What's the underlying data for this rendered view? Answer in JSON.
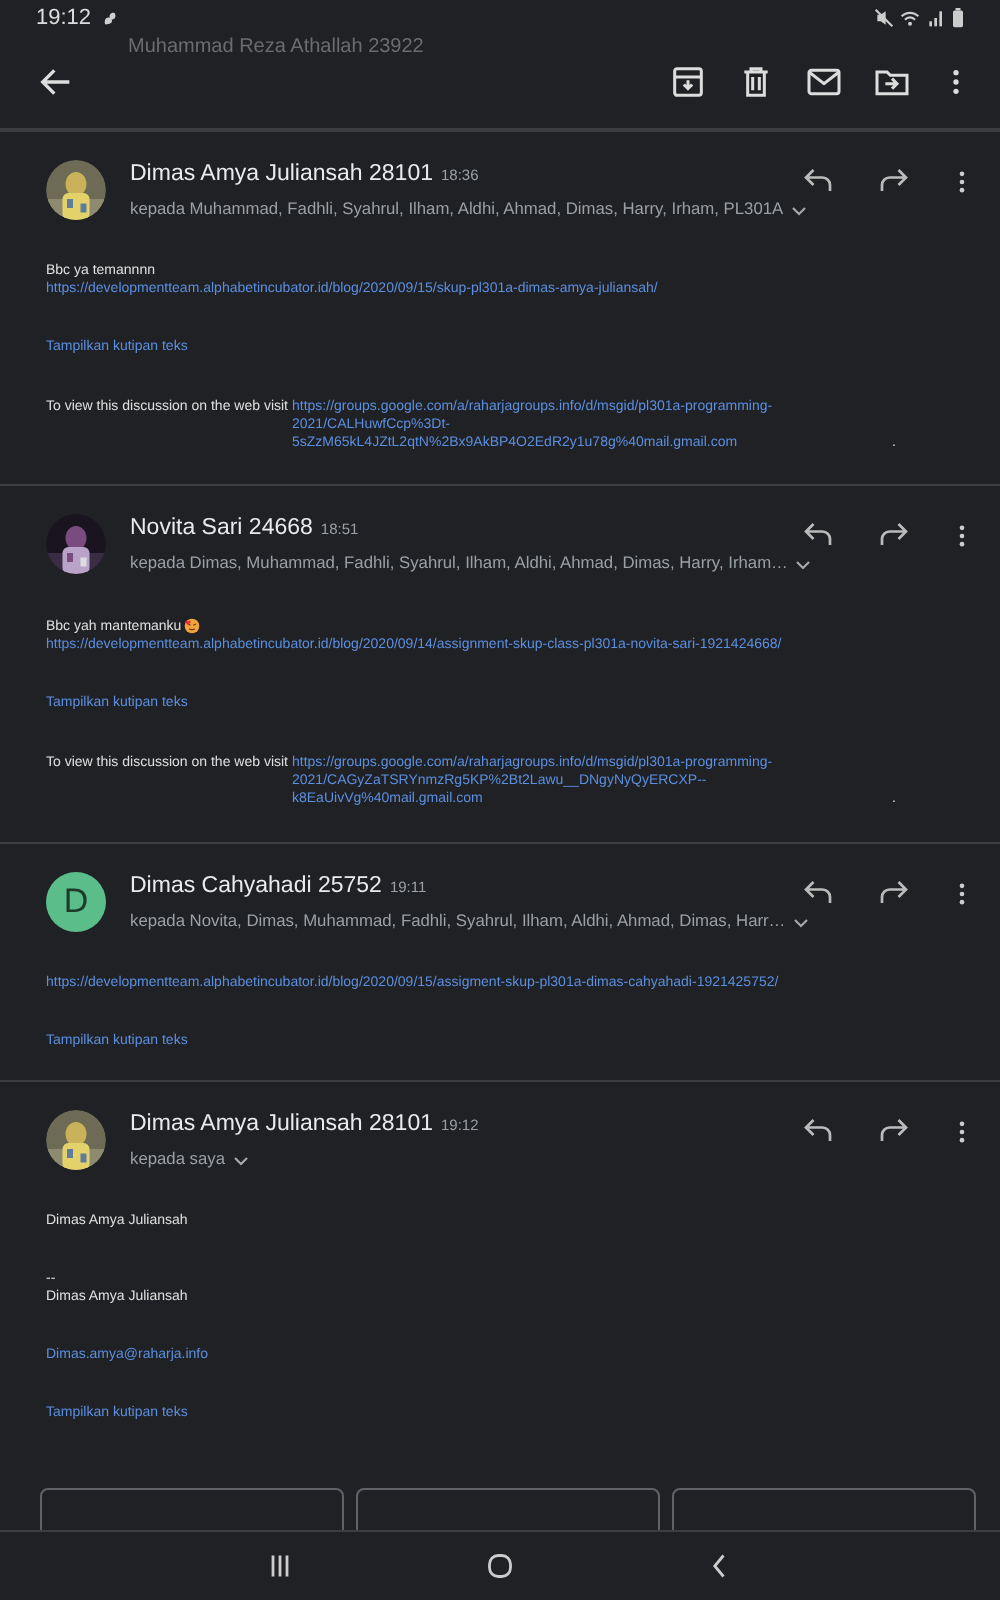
{
  "status_bar": {
    "time": "19:12"
  },
  "behind_toolbar": {
    "sender": "Muhammad Reza Athallah 23922"
  },
  "messages": [
    {
      "sender": "Dimas Amya Juliansah 28101",
      "time": "18:36",
      "recipients": "kepada Muhammad, Fadhli, Syahrul, Ilham, Aldhi, Ahmad, Dimas, Harry, Irham, PL301A",
      "avatar": {
        "kind": "picture"
      },
      "blocks": [
        {
          "kind": "para",
          "lines": [
            {
              "kind": "text",
              "text": "Bbc ya temannnn"
            },
            {
              "kind": "link",
              "text": "https://developmentteam.alphabetincubator.id/blog/2020/09/15/skup-pl301a-dimas-amya-juliansah/"
            }
          ]
        },
        {
          "kind": "toggle",
          "text": "Tampilkan kutipan teks"
        },
        {
          "kind": "visit",
          "text": "To view this discussion on the web visit",
          "link": "https://groups.google.com/a/raharjagroups.info/d/msgid/pl301a-programming-2021/CALHuwfCcp%3Dt-5sZzM65kL4JZtL2qtN%2Bx9AkBP4O2EdR2y1u78g%40mail.gmail.com",
          "end": "."
        }
      ]
    },
    {
      "sender": "Novita Sari 24668",
      "time": "18:51",
      "recipients": "kepada Dimas, Muhammad, Fadhli, Syahrul, Ilham, Aldhi, Ahmad, Dimas, Harry, Irham…",
      "avatar": {
        "kind": "picture"
      },
      "blocks": [
        {
          "kind": "para",
          "lines": [
            {
              "kind": "text_with_emoji",
              "text": "Bbc yah mantemanku"
            },
            {
              "kind": "link",
              "text": "https://developmentteam.alphabetincubator.id/blog/2020/09/14/assignment-skup-class-pl301a-novita-sari-1921424668/"
            }
          ]
        },
        {
          "kind": "toggle",
          "text": "Tampilkan kutipan teks"
        },
        {
          "kind": "visit",
          "text": "To view this discussion on the web visit",
          "link": "https://groups.google.com/a/raharjagroups.info/d/msgid/pl301a-programming-2021/CAGyZaTSRYnmzRg5KP%2Bt2Lawu__DNgyNyQyERCXP--k8EaUivVg%40mail.gmail.com",
          "end": "."
        }
      ]
    },
    {
      "sender": "Dimas Cahyahadi 25752",
      "time": "19:11",
      "recipients": "kepada Novita, Dimas, Muhammad, Fadhli, Syahrul, Ilham, Aldhi, Ahmad, Dimas, Harr…",
      "avatar": {
        "kind": "letter",
        "letter": "D",
        "color": "#5bbd8a"
      },
      "blocks": [
        {
          "kind": "para",
          "lines": [
            {
              "kind": "link",
              "text": "https://developmentteam.alphabetincubator.id/blog/2020/09/15/assigment-skup-pl301a-dimas-cahyahadi-1921425752/"
            }
          ]
        },
        {
          "kind": "toggle",
          "text": "Tampilkan kutipan teks"
        }
      ]
    },
    {
      "sender": "Dimas Amya Juliansah 28101",
      "time": "19:12",
      "recipients": "kepada saya",
      "avatar": {
        "kind": "picture"
      },
      "blocks": [
        {
          "kind": "para",
          "lines": [
            {
              "kind": "text",
              "text": "Dimas Amya Juliansah"
            }
          ]
        },
        {
          "kind": "para",
          "lines": [
            {
              "kind": "text",
              "text": "--"
            },
            {
              "kind": "text",
              "text": "Dimas Amya Juliansah"
            }
          ]
        },
        {
          "kind": "para",
          "lines": [
            {
              "kind": "link",
              "text": "Dimas.amya@raharja.info"
            }
          ]
        },
        {
          "kind": "toggle",
          "text": "Tampilkan kutipan teks"
        }
      ]
    }
  ]
}
